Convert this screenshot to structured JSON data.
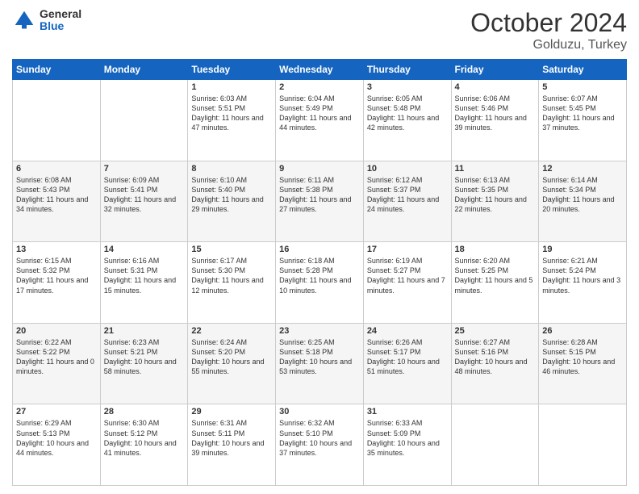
{
  "logo": {
    "general": "General",
    "blue": "Blue"
  },
  "header": {
    "month": "October 2024",
    "location": "Golduzu, Turkey"
  },
  "weekdays": [
    "Sunday",
    "Monday",
    "Tuesday",
    "Wednesday",
    "Thursday",
    "Friday",
    "Saturday"
  ],
  "weeks": [
    [
      {
        "day": "",
        "info": ""
      },
      {
        "day": "",
        "info": ""
      },
      {
        "day": "1",
        "info": "Sunrise: 6:03 AM\nSunset: 5:51 PM\nDaylight: 11 hours and 47 minutes."
      },
      {
        "day": "2",
        "info": "Sunrise: 6:04 AM\nSunset: 5:49 PM\nDaylight: 11 hours and 44 minutes."
      },
      {
        "day": "3",
        "info": "Sunrise: 6:05 AM\nSunset: 5:48 PM\nDaylight: 11 hours and 42 minutes."
      },
      {
        "day": "4",
        "info": "Sunrise: 6:06 AM\nSunset: 5:46 PM\nDaylight: 11 hours and 39 minutes."
      },
      {
        "day": "5",
        "info": "Sunrise: 6:07 AM\nSunset: 5:45 PM\nDaylight: 11 hours and 37 minutes."
      }
    ],
    [
      {
        "day": "6",
        "info": "Sunrise: 6:08 AM\nSunset: 5:43 PM\nDaylight: 11 hours and 34 minutes."
      },
      {
        "day": "7",
        "info": "Sunrise: 6:09 AM\nSunset: 5:41 PM\nDaylight: 11 hours and 32 minutes."
      },
      {
        "day": "8",
        "info": "Sunrise: 6:10 AM\nSunset: 5:40 PM\nDaylight: 11 hours and 29 minutes."
      },
      {
        "day": "9",
        "info": "Sunrise: 6:11 AM\nSunset: 5:38 PM\nDaylight: 11 hours and 27 minutes."
      },
      {
        "day": "10",
        "info": "Sunrise: 6:12 AM\nSunset: 5:37 PM\nDaylight: 11 hours and 24 minutes."
      },
      {
        "day": "11",
        "info": "Sunrise: 6:13 AM\nSunset: 5:35 PM\nDaylight: 11 hours and 22 minutes."
      },
      {
        "day": "12",
        "info": "Sunrise: 6:14 AM\nSunset: 5:34 PM\nDaylight: 11 hours and 20 minutes."
      }
    ],
    [
      {
        "day": "13",
        "info": "Sunrise: 6:15 AM\nSunset: 5:32 PM\nDaylight: 11 hours and 17 minutes."
      },
      {
        "day": "14",
        "info": "Sunrise: 6:16 AM\nSunset: 5:31 PM\nDaylight: 11 hours and 15 minutes."
      },
      {
        "day": "15",
        "info": "Sunrise: 6:17 AM\nSunset: 5:30 PM\nDaylight: 11 hours and 12 minutes."
      },
      {
        "day": "16",
        "info": "Sunrise: 6:18 AM\nSunset: 5:28 PM\nDaylight: 11 hours and 10 minutes."
      },
      {
        "day": "17",
        "info": "Sunrise: 6:19 AM\nSunset: 5:27 PM\nDaylight: 11 hours and 7 minutes."
      },
      {
        "day": "18",
        "info": "Sunrise: 6:20 AM\nSunset: 5:25 PM\nDaylight: 11 hours and 5 minutes."
      },
      {
        "day": "19",
        "info": "Sunrise: 6:21 AM\nSunset: 5:24 PM\nDaylight: 11 hours and 3 minutes."
      }
    ],
    [
      {
        "day": "20",
        "info": "Sunrise: 6:22 AM\nSunset: 5:22 PM\nDaylight: 11 hours and 0 minutes."
      },
      {
        "day": "21",
        "info": "Sunrise: 6:23 AM\nSunset: 5:21 PM\nDaylight: 10 hours and 58 minutes."
      },
      {
        "day": "22",
        "info": "Sunrise: 6:24 AM\nSunset: 5:20 PM\nDaylight: 10 hours and 55 minutes."
      },
      {
        "day": "23",
        "info": "Sunrise: 6:25 AM\nSunset: 5:18 PM\nDaylight: 10 hours and 53 minutes."
      },
      {
        "day": "24",
        "info": "Sunrise: 6:26 AM\nSunset: 5:17 PM\nDaylight: 10 hours and 51 minutes."
      },
      {
        "day": "25",
        "info": "Sunrise: 6:27 AM\nSunset: 5:16 PM\nDaylight: 10 hours and 48 minutes."
      },
      {
        "day": "26",
        "info": "Sunrise: 6:28 AM\nSunset: 5:15 PM\nDaylight: 10 hours and 46 minutes."
      }
    ],
    [
      {
        "day": "27",
        "info": "Sunrise: 6:29 AM\nSunset: 5:13 PM\nDaylight: 10 hours and 44 minutes."
      },
      {
        "day": "28",
        "info": "Sunrise: 6:30 AM\nSunset: 5:12 PM\nDaylight: 10 hours and 41 minutes."
      },
      {
        "day": "29",
        "info": "Sunrise: 6:31 AM\nSunset: 5:11 PM\nDaylight: 10 hours and 39 minutes."
      },
      {
        "day": "30",
        "info": "Sunrise: 6:32 AM\nSunset: 5:10 PM\nDaylight: 10 hours and 37 minutes."
      },
      {
        "day": "31",
        "info": "Sunrise: 6:33 AM\nSunset: 5:09 PM\nDaylight: 10 hours and 35 minutes."
      },
      {
        "day": "",
        "info": ""
      },
      {
        "day": "",
        "info": ""
      }
    ]
  ]
}
